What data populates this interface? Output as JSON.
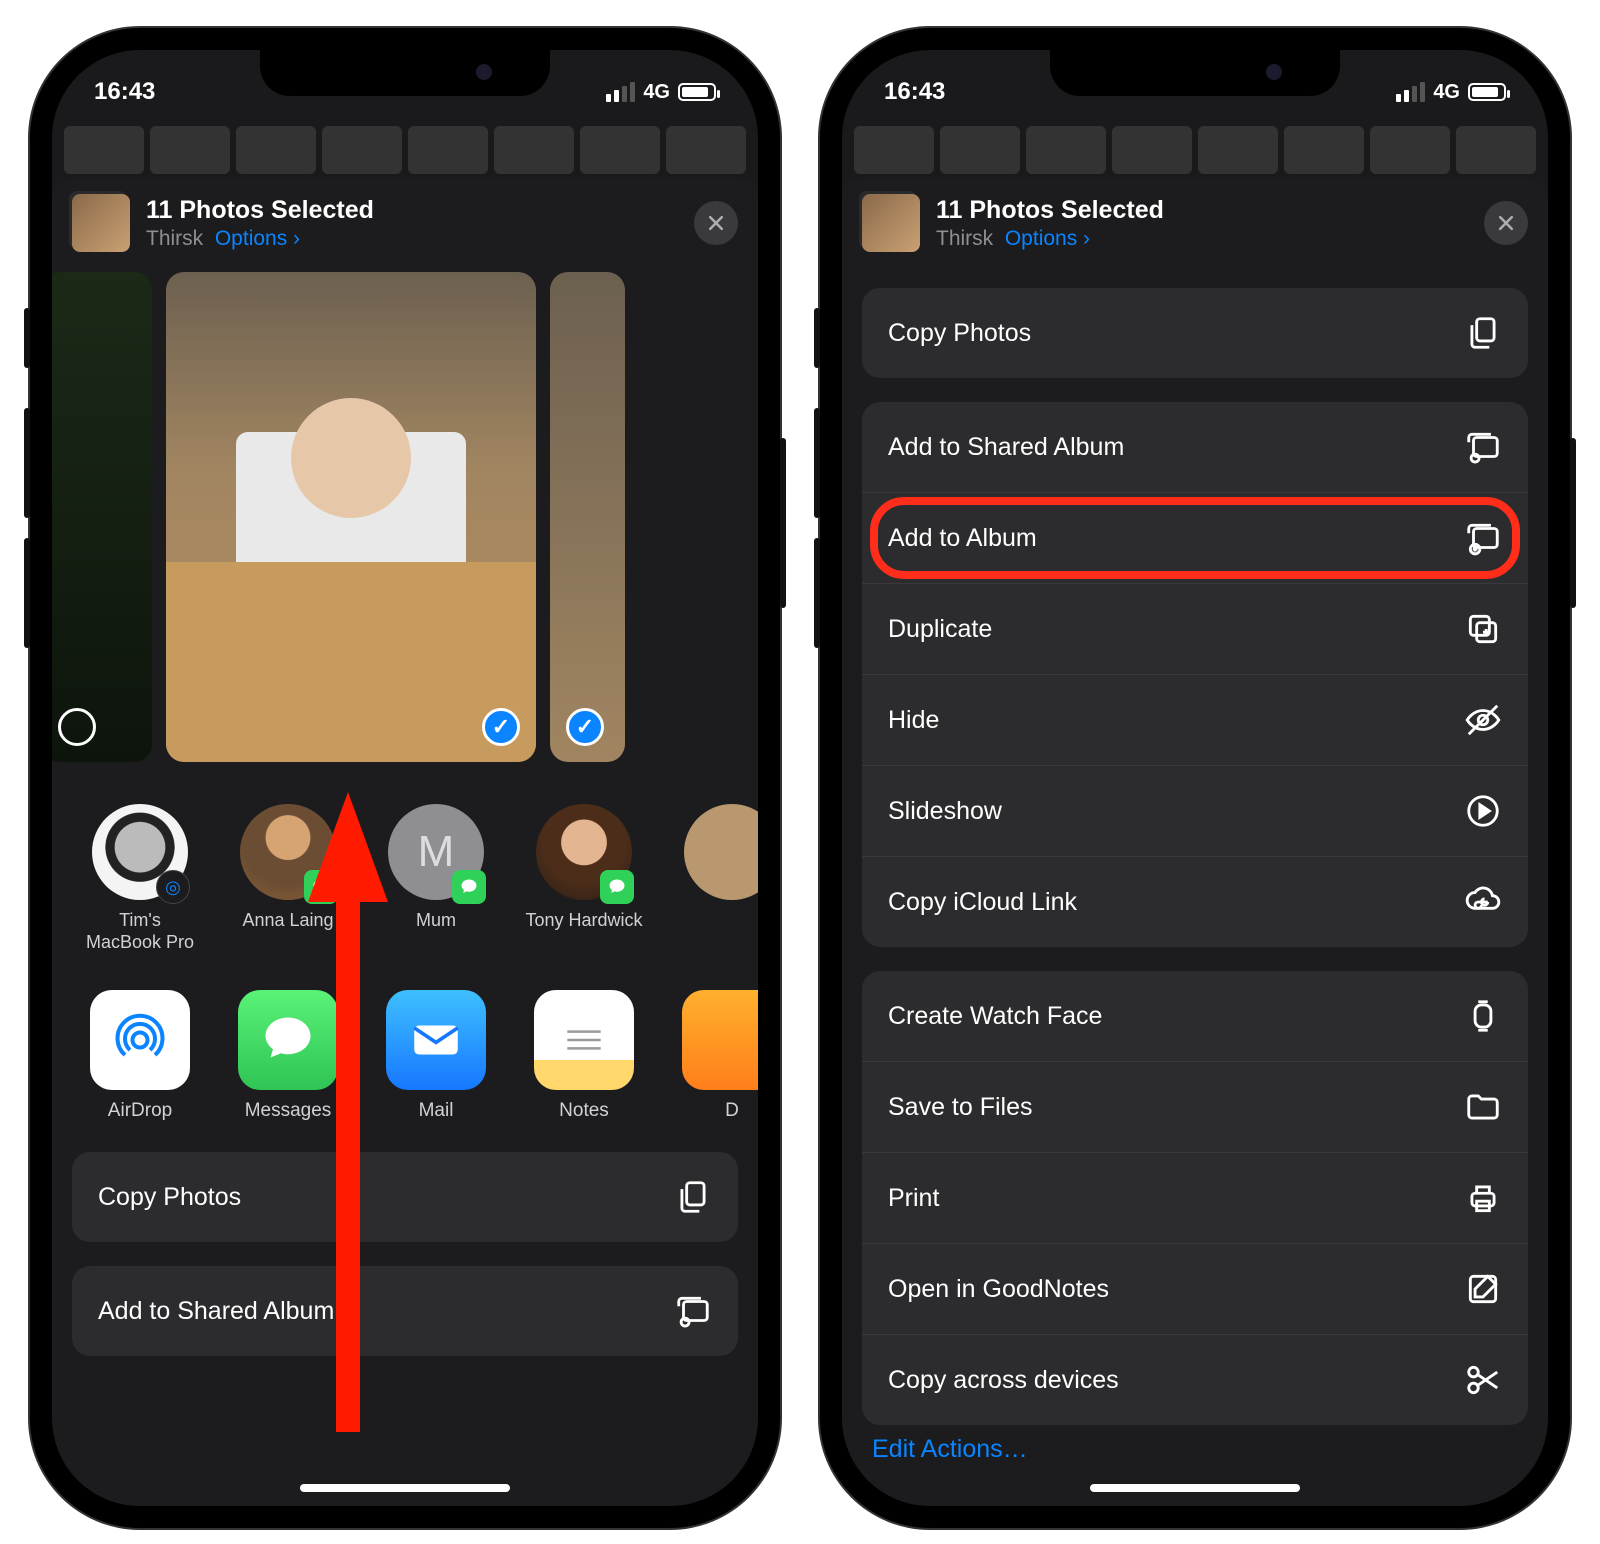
{
  "status": {
    "time": "16:43",
    "network": "4G"
  },
  "sheet": {
    "title": "11 Photos Selected",
    "location": "Thirsk",
    "options_label": "Options"
  },
  "contacts": [
    {
      "name": "Tim's MacBook Pro"
    },
    {
      "name": "Anna Laing"
    },
    {
      "name": "Mum"
    },
    {
      "name": "Tony Hardwick"
    }
  ],
  "apps": [
    {
      "name": "AirDrop"
    },
    {
      "name": "Messages"
    },
    {
      "name": "Mail"
    },
    {
      "name": "Notes"
    },
    {
      "name": "D"
    }
  ],
  "actions_left": [
    {
      "label": "Copy Photos",
      "icon": "copy"
    },
    {
      "label": "Add to Shared Album",
      "icon": "shared-album"
    }
  ],
  "actions_right_group1": [
    {
      "label": "Copy Photos",
      "icon": "copy"
    }
  ],
  "actions_right_group2": [
    {
      "label": "Add to Shared Album",
      "icon": "shared-album"
    },
    {
      "label": "Add to Album",
      "icon": "add-album",
      "highlighted": true
    },
    {
      "label": "Duplicate",
      "icon": "duplicate"
    },
    {
      "label": "Hide",
      "icon": "hide"
    },
    {
      "label": "Slideshow",
      "icon": "play"
    },
    {
      "label": "Copy iCloud Link",
      "icon": "link"
    }
  ],
  "actions_right_group3": [
    {
      "label": "Create Watch Face",
      "icon": "watch"
    },
    {
      "label": "Save to Files",
      "icon": "folder"
    },
    {
      "label": "Print",
      "icon": "printer"
    },
    {
      "label": "Open in GoodNotes",
      "icon": "note-edit"
    },
    {
      "label": "Copy across devices",
      "icon": "scissors"
    }
  ],
  "edit_actions_label": "Edit Actions…",
  "mum_initial": "M"
}
